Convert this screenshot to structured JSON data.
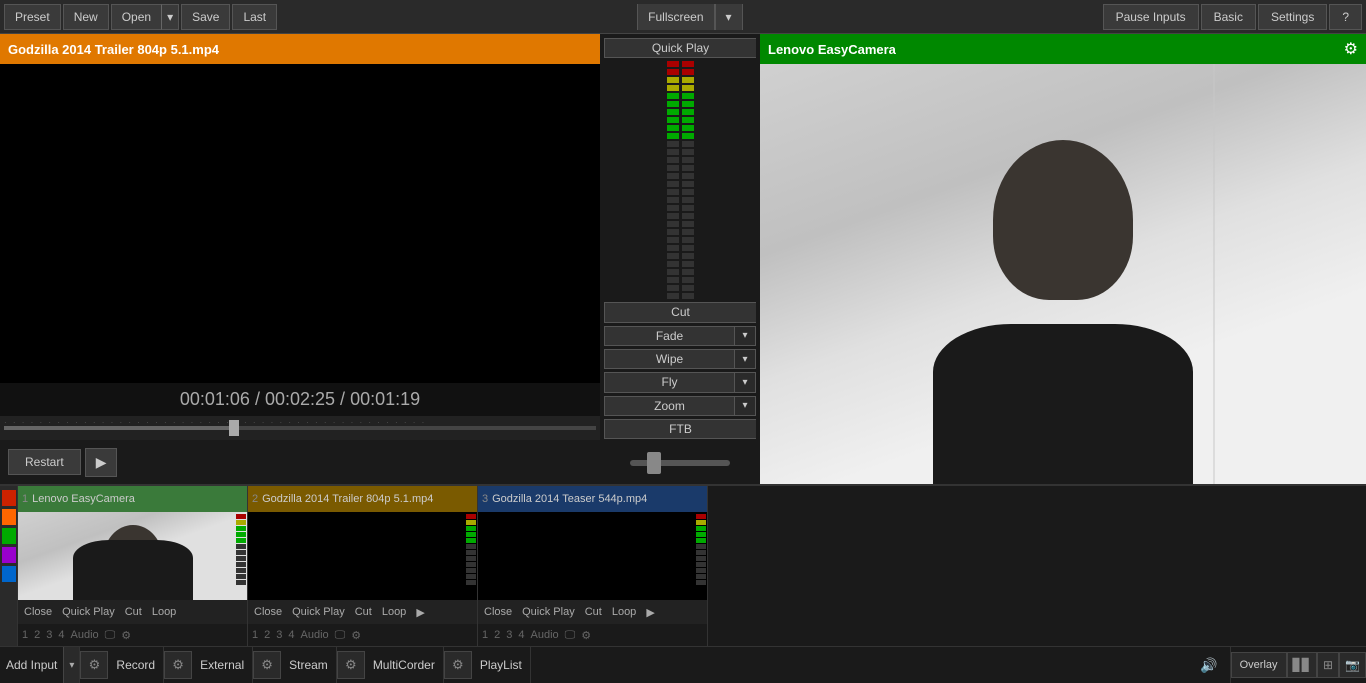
{
  "topbar": {
    "preset_label": "Preset",
    "new_label": "New",
    "open_label": "Open",
    "save_label": "Save",
    "last_label": "Last",
    "fullscreen_label": "Fullscreen",
    "pause_inputs_label": "Pause Inputs",
    "basic_label": "Basic",
    "settings_label": "Settings",
    "help_label": "?"
  },
  "left_panel": {
    "title": "Godzilla 2014 Trailer 804p 5.1.mp4",
    "time_current": "00:01:06",
    "time_total": "00:02:25",
    "time_remaining": "00:01:19",
    "restart_label": "Restart",
    "play_label": "▶"
  },
  "middle_panel": {
    "quick_play_label": "Quick Play",
    "cut_label": "Cut",
    "fade_label": "Fade",
    "wipe_label": "Wipe",
    "fly_label": "Fly",
    "zoom_label": "Zoom",
    "ftb_label": "FTB"
  },
  "right_panel": {
    "camera_title": "Lenovo EasyCamera",
    "gear_icon": "⚙"
  },
  "lower_panel": {
    "inputs": [
      {
        "num": "1",
        "name": "Lenovo EasyCamera",
        "title_class": "input-title-1",
        "close_label": "Close",
        "quick_play_label": "Quick Play",
        "cut_label": "Cut",
        "loop_label": "Loop",
        "num1": "1",
        "num2": "2",
        "num3": "3",
        "num4": "4",
        "audio_label": "Audio"
      },
      {
        "num": "2",
        "name": "Godzilla 2014 Trailer 804p 5.1.mp4",
        "title_class": "input-title-2",
        "close_label": "Close",
        "quick_play_label": "Quick Play",
        "cut_label": "Cut",
        "loop_label": "Loop",
        "num1": "1",
        "num2": "2",
        "num3": "3",
        "num4": "4",
        "audio_label": "Audio"
      },
      {
        "num": "3",
        "name": "Godzilla 2014 Teaser 544p.mp4",
        "title_class": "input-title-3",
        "close_label": "Close",
        "quick_play_label": "Quick Play",
        "cut_label": "Cut",
        "loop_label": "Loop",
        "num1": "1",
        "num2": "2",
        "num3": "3",
        "num4": "4",
        "audio_label": "Audio"
      }
    ],
    "color_strips": [
      "#cc2200",
      "#ff6600",
      "#00aa00",
      "#9900cc",
      "#0066cc"
    ]
  },
  "bottom_bar": {
    "add_input_label": "Add Input",
    "record_label": "Record",
    "external_label": "External",
    "stream_label": "Stream",
    "multicorder_label": "MultiCorder",
    "playlist_label": "PlayList",
    "overlay_label": "Overlay"
  }
}
